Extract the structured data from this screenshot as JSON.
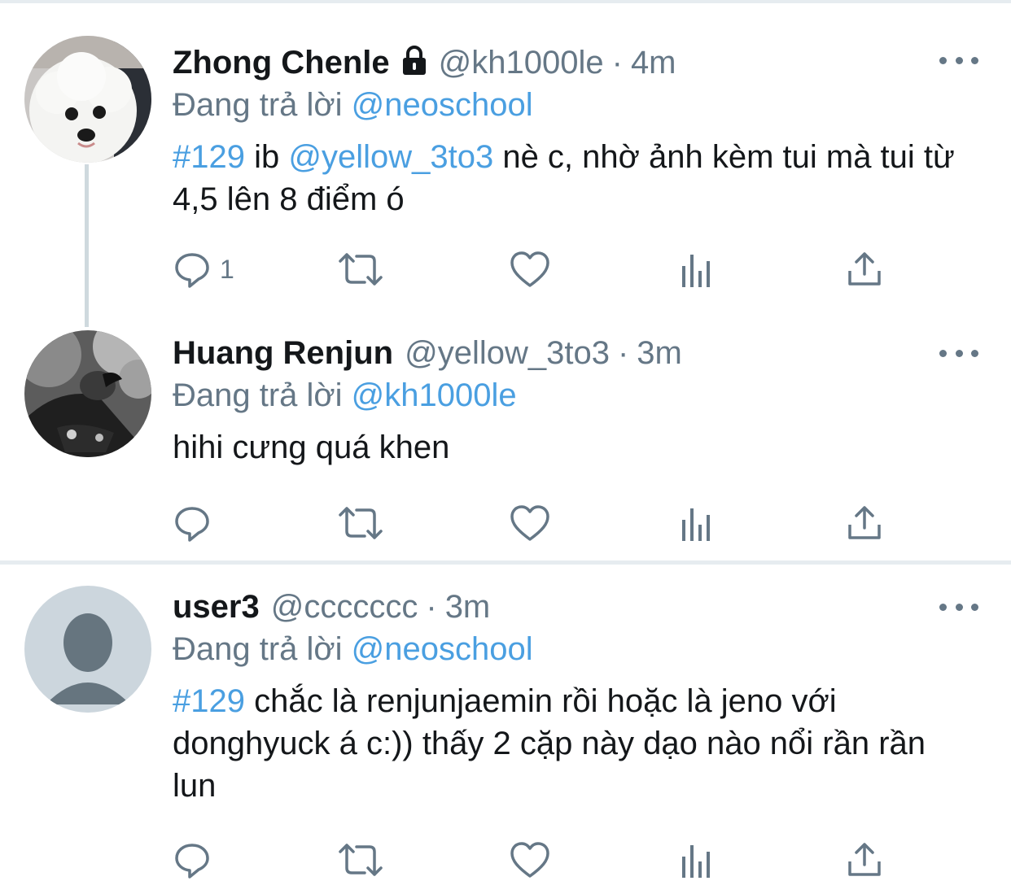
{
  "tweets": [
    {
      "name": "Zhong Chenle",
      "protected": true,
      "handle": "@kh1000le",
      "time": "4m",
      "replying_label": "Đang trả lời",
      "replying_to": "@neoschool",
      "text_parts": [
        {
          "type": "link",
          "value": "#129"
        },
        {
          "type": "text",
          "value": " ib "
        },
        {
          "type": "link",
          "value": "@yellow_3to3"
        },
        {
          "type": "text",
          "value": " nè c, nhờ ảnh kèm tui mà tui từ 4,5 lên 8 điểm ó"
        }
      ],
      "reply_count": "1",
      "avatar": "white-dog-photo"
    },
    {
      "name": "Huang Renjun",
      "protected": false,
      "handle": "@yellow_3to3",
      "time": "3m",
      "replying_label": "Đang trả lời",
      "replying_to": "@kh1000le",
      "text_parts": [
        {
          "type": "text",
          "value": "hihi cưng quá khen"
        }
      ],
      "reply_count": "",
      "avatar": "bw-portrait-photo"
    },
    {
      "name": "user3",
      "protected": false,
      "handle": "@ccccccc",
      "time": "3m",
      "replying_label": "Đang trả lời",
      "replying_to": "@neoschool",
      "text_parts": [
        {
          "type": "link",
          "value": "#129"
        },
        {
          "type": "text",
          "value": " chắc là renjunjaemin rồi hoặc là jeno với donghyuck á c:)) thấy 2 cặp này dạo nào nổi rần rần lun"
        }
      ],
      "reply_count": "",
      "avatar": "default-avatar"
    }
  ],
  "icons": {
    "reply": "speech-bubble-icon",
    "retweet": "retweet-icon",
    "like": "heart-icon",
    "analytics": "bar-chart-icon",
    "share": "share-icon",
    "more": "ellipsis-icon",
    "lock": "lock-icon"
  },
  "colors": {
    "link": "#4a9fe1",
    "secondary_text": "#657786",
    "primary_text": "#14171a",
    "divider": "#e6ecf0"
  }
}
